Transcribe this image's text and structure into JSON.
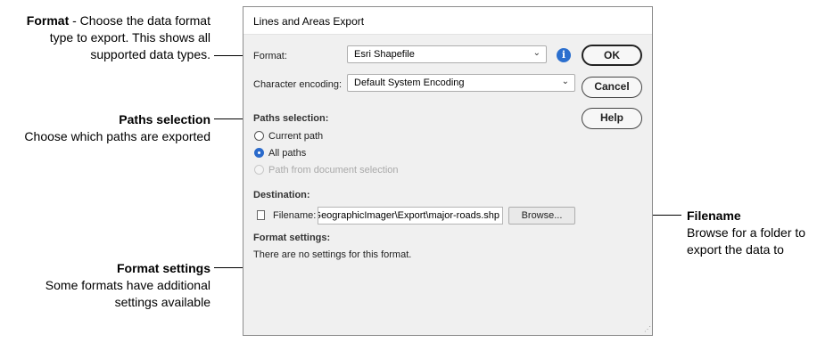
{
  "callouts": {
    "format": {
      "title": "Format",
      "text": " - Choose the data format type to export. This shows all supported data types."
    },
    "paths": {
      "title": "Paths selection",
      "text": "Choose which paths are exported"
    },
    "format_settings": {
      "title": "Format settings",
      "text": "Some formats have additional settings available"
    },
    "filename": {
      "title": "Filename",
      "text": "Browse for a folder to export the data to"
    }
  },
  "dialog": {
    "title": "Lines and Areas Export",
    "format_label": "Format:",
    "format_value": "Esri Shapefile",
    "encoding_label": "Character encoding:",
    "encoding_value": "Default System Encoding",
    "buttons": {
      "ok": "OK",
      "cancel": "Cancel",
      "help": "Help"
    },
    "paths_heading": "Paths selection:",
    "radios": [
      {
        "label": "Current path",
        "state": "unchecked"
      },
      {
        "label": "All paths",
        "state": "checked"
      },
      {
        "label": "Path from document selection",
        "state": "disabled"
      }
    ],
    "destination_heading": "Destination:",
    "filename_label": "Filename:",
    "filename_value": "C:\\Users\\Public\\GeographicImager\\Export\\major-roads.shp",
    "browse_label": "Browse...",
    "format_settings_heading": "Format settings:",
    "format_settings_text": "There are no settings for this format.",
    "info_icon": "info-icon",
    "accent_color": "#2b6fce"
  }
}
